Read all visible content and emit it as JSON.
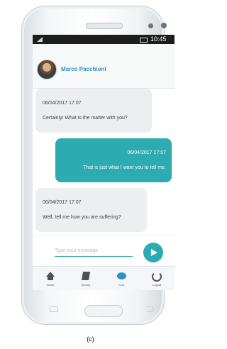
{
  "status_bar": {
    "time": "10:45"
  },
  "header": {
    "contact_name": "Marco Pacchioni"
  },
  "messages": [
    {
      "direction": "in",
      "timestamp": "06/04/2017 17:07",
      "text": "Certainly! What is the matter with you?"
    },
    {
      "direction": "out",
      "timestamp": "06/04/2017 17:07",
      "text": "That is just what I want you to tell me."
    },
    {
      "direction": "in",
      "timestamp": "06/04/2017 17:07",
      "text": "Well, tell me how you are suffering?"
    }
  ],
  "composer": {
    "placeholder": "Type your message"
  },
  "tabs": [
    {
      "label": "Home",
      "icon": "home-icon"
    },
    {
      "label": "Survey",
      "icon": "survey-icon"
    },
    {
      "label": "Chat",
      "icon": "chat-icon"
    },
    {
      "label": "Logout",
      "icon": "logout-icon"
    }
  ],
  "caption": "(c)",
  "colors": {
    "accent": "#2cabb1",
    "link": "#2e8fc7",
    "incoming": "#eceeef"
  }
}
